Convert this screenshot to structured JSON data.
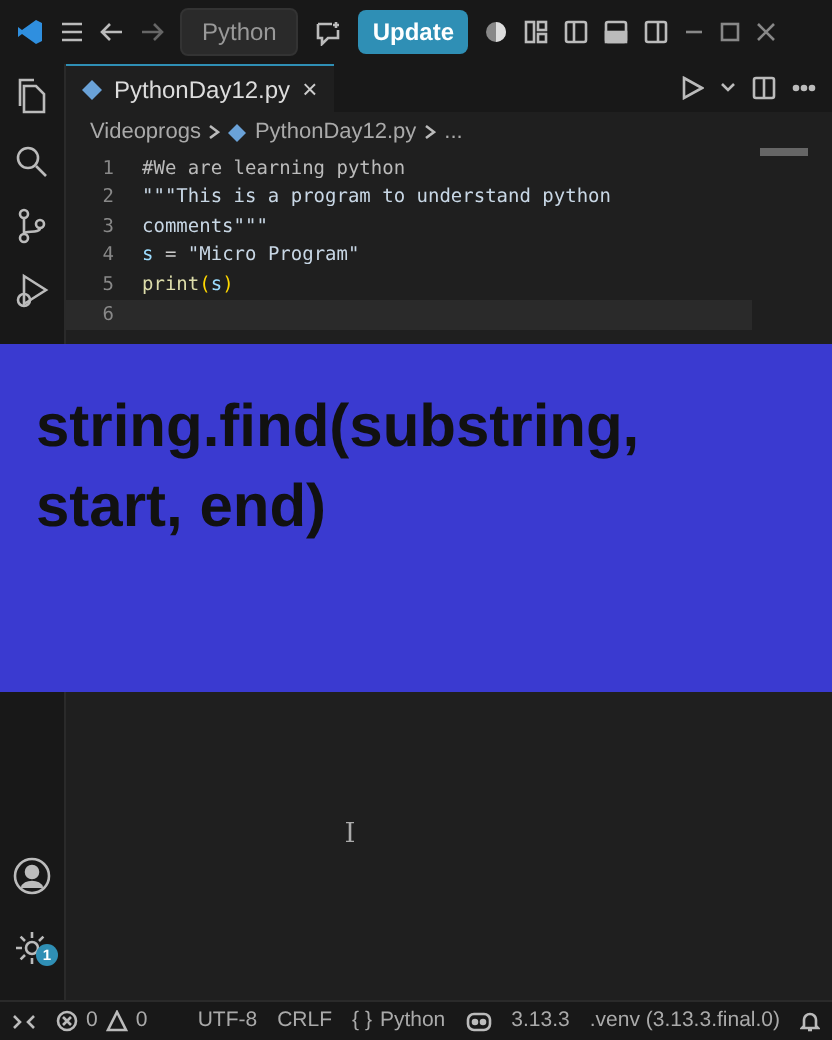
{
  "title_bar": {
    "search": "Python",
    "update_button": "Update"
  },
  "tab": {
    "label": "PythonDay12.py",
    "close": "×",
    "selected": true
  },
  "breadcrumbs": [
    "Videoprogs",
    "PythonDay12.py",
    "..."
  ],
  "code_lines": [
    {
      "number": "1",
      "current": false,
      "tokens": [
        {
          "kind": "comment",
          "text": "#We are learning python"
        }
      ]
    },
    {
      "number": "2",
      "current": false,
      "tokens": [
        {
          "kind": "string",
          "text": "\"\"\"This is a program to understand python"
        }
      ]
    },
    {
      "number": "3",
      "current": false,
      "tokens": [
        {
          "kind": "string",
          "text": "comments\"\"\""
        }
      ]
    },
    {
      "number": "4",
      "current": false,
      "tokens": [
        {
          "kind": "variable",
          "text": "s"
        },
        {
          "kind": "plain",
          "text": " = "
        },
        {
          "kind": "string",
          "text": "\"Micro Program\""
        }
      ]
    },
    {
      "number": "5",
      "current": false,
      "tokens": [
        {
          "kind": "function",
          "text": "print"
        },
        {
          "kind": "paren",
          "text": "("
        },
        {
          "kind": "variable",
          "text": "s"
        },
        {
          "kind": "paren",
          "text": ")"
        }
      ]
    },
    {
      "number": "6",
      "current": true
    }
  ],
  "banner": {
    "lines": [
      "string.find(substring,",
      "start, end)"
    ]
  },
  "settings_badge": "1",
  "status_bar": {
    "errors": "0",
    "warnings": "0",
    "encoding": "UTF-8",
    "line_ending": "CRLF",
    "language_icon": "{ }",
    "language": "Python",
    "version": "3.13.3",
    "environment": ".venv (3.13.3.final.0)"
  }
}
